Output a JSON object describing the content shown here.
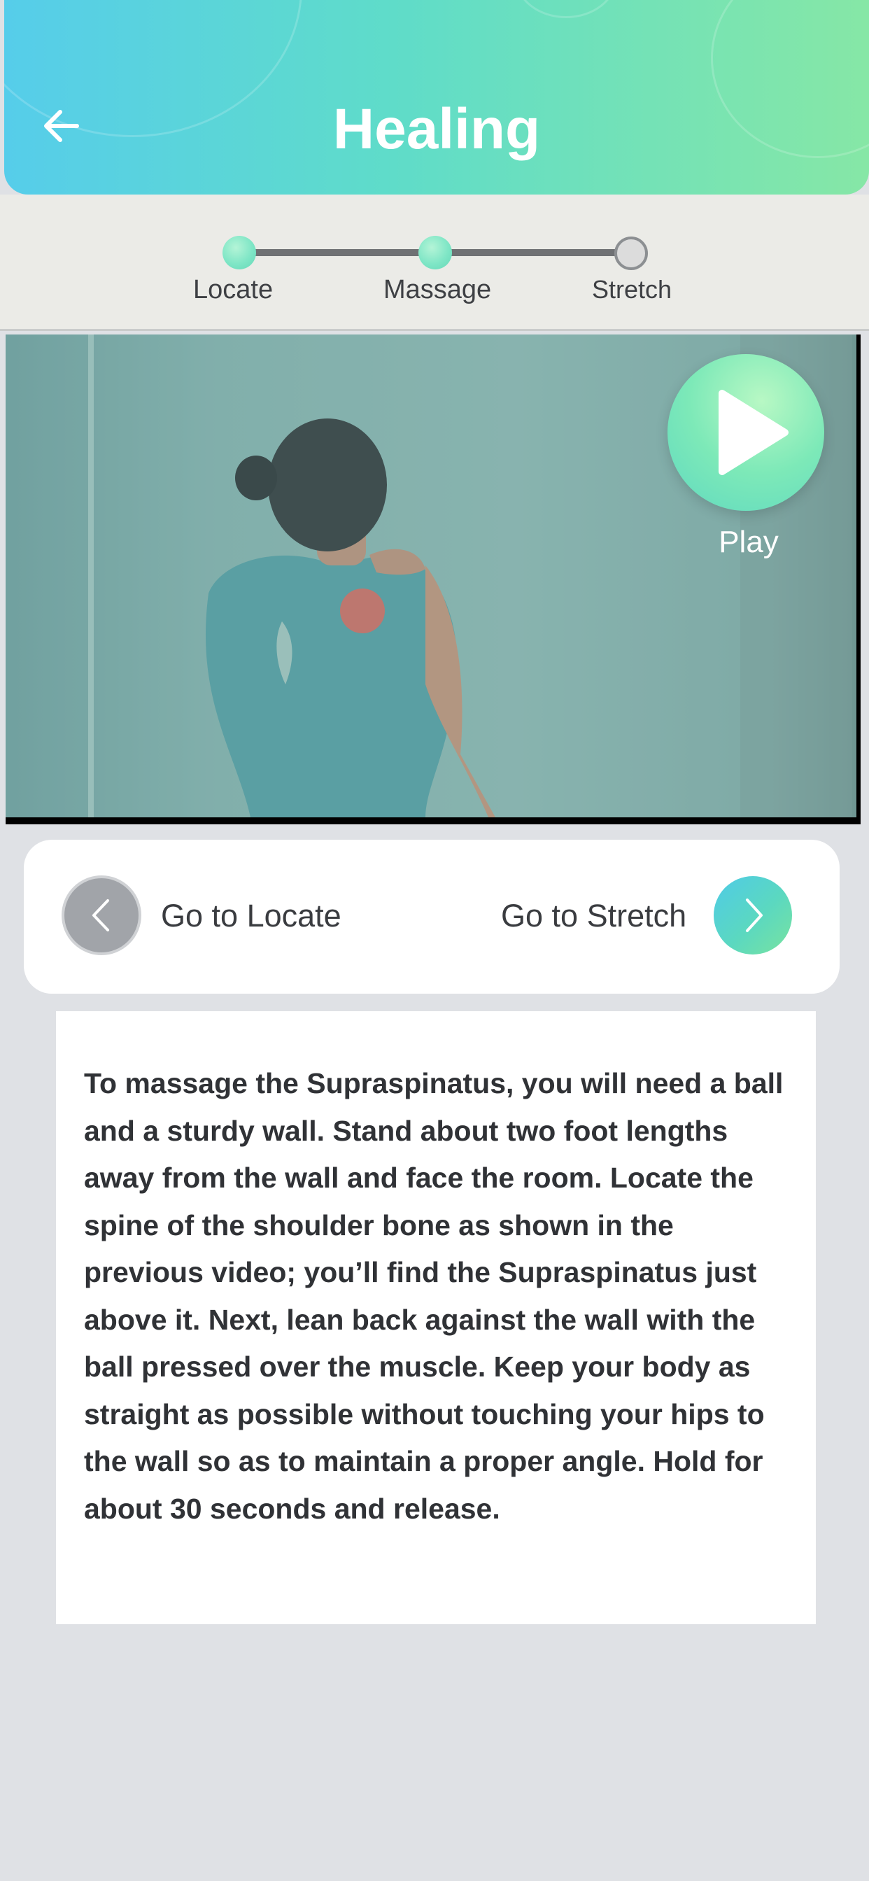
{
  "header": {
    "title": "Healing",
    "back_icon": "arrow-left-icon",
    "gradient_colors": [
      "#56cdea",
      "#5fdcc9",
      "#86e7a6"
    ]
  },
  "stepper": {
    "steps": [
      {
        "label": "Locate",
        "state": "completed"
      },
      {
        "label": "Massage",
        "state": "current"
      },
      {
        "label": "Stretch",
        "state": "upcoming"
      }
    ]
  },
  "video": {
    "play_label": "Play",
    "play_icon": "play-icon"
  },
  "navigation": {
    "prev_label": "Go to Locate",
    "prev_icon": "chevron-left-icon",
    "next_label": "Go to Stretch",
    "next_icon": "chevron-right-icon"
  },
  "description": {
    "text": "To massage the Supraspinatus, you will need a ball and a sturdy wall. Stand about two foot lengths away from the wall and face the room. Locate the spine of the shoulder bone as shown in the previous video; you’ll find the Supraspinatus just above it. Next, lean back against the wall with the ball pressed over the muscle. Keep your body as straight as possible without touching your hips to the wall so as to maintain a proper angle. Hold for about 30 seconds and release."
  }
}
